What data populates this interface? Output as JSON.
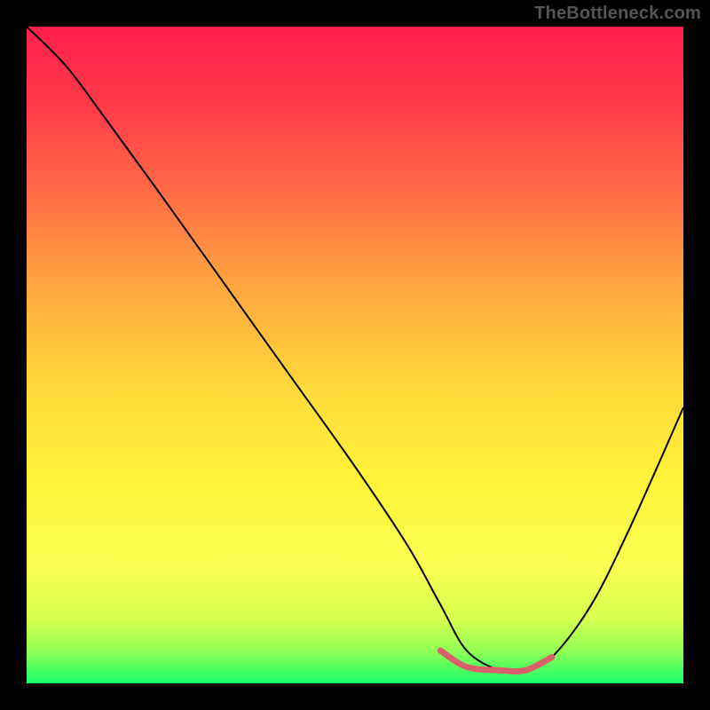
{
  "watermark": "TheBottleneck.com",
  "colors": {
    "frame": "#000000",
    "curve_stroke": "#000000",
    "accent_stroke": "#d9626a",
    "gradient_stops": [
      {
        "offset": 0.0,
        "color": "#ff1f4b"
      },
      {
        "offset": 0.12,
        "color": "#ff3a4a"
      },
      {
        "offset": 0.25,
        "color": "#ff6a45"
      },
      {
        "offset": 0.4,
        "color": "#ffa83f"
      },
      {
        "offset": 0.55,
        "color": "#ffd93a"
      },
      {
        "offset": 0.7,
        "color": "#fff43a"
      },
      {
        "offset": 0.82,
        "color": "#fbff52"
      },
      {
        "offset": 0.9,
        "color": "#d9ff4f"
      },
      {
        "offset": 0.95,
        "color": "#93ff55"
      },
      {
        "offset": 1.0,
        "color": "#18ff6a"
      }
    ]
  },
  "chart_data": {
    "type": "line",
    "title": "",
    "xlabel": "",
    "ylabel": "",
    "xlim": [
      0,
      100
    ],
    "ylim": [
      0,
      100
    ],
    "grid": false,
    "series": [
      {
        "name": "bottleneck-curve",
        "x": [
          0,
          6,
          12,
          20,
          30,
          40,
          50,
          58,
          63,
          67,
          72,
          76,
          80,
          86,
          92,
          100
        ],
        "y": [
          100,
          94,
          86,
          75,
          61,
          47,
          33,
          21,
          12,
          5,
          2,
          2,
          4,
          12,
          24,
          42
        ]
      }
    ],
    "accent_segment": {
      "name": "optimal-range-marker",
      "x": [
        63,
        67,
        72,
        76,
        80
      ],
      "y": [
        5,
        2.5,
        2,
        2,
        4
      ]
    }
  }
}
